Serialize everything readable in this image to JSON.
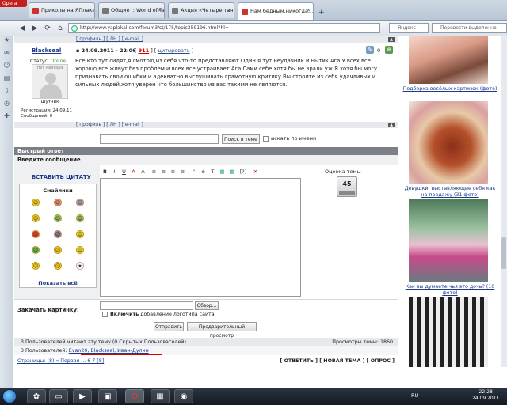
{
  "browser": {
    "menu_label": "Opera",
    "tabs": [
      {
        "title": "Приколы на ЯПлакалъ"
      },
      {
        "title": "Общие :: World of Ta..."
      },
      {
        "title": "Акция «Четыре танки..."
      },
      {
        "title": "Нам бедным,никогда..."
      }
    ],
    "url": "http://www.yaplakal.com/forum3/st/175/topic359196.html?hl=",
    "search_engine": "Яндекс",
    "translate_placeholder": "Перевести выделенно"
  },
  "post": {
    "top_links": "[ профиль ] [ ЛН ] [ e-mail ]",
    "author": "Blackseal",
    "date": "24.09.2011 - 22:06",
    "reputation": "911",
    "quote_label": "цитировать",
    "status_label": "Статус:",
    "status_value": "Online",
    "avatar_label": "Нет Аватара",
    "rank": "Шутник",
    "reg_label": "Регистрация: 24.09.11",
    "posts_label": "Сообщений: 0",
    "comment_count": "0",
    "text": "Все кто тут сидят,я смотрю,из себя что-то представляют.Один я тут неудачник и нытик.Ага.У всех все хорошо,все живут без проблем и всех все устраивает.Ага.Сами себе хотя бы не врали уж.Я хотя бы могу признавать свои ошибки и адекватно выслушивать грамотную критику.Вы строите из себя удачливых и сильных людей,хотя уверен что большинство из вас такими не являются.",
    "bottom_links": "[ профиль ] [ ЛН ] [ e-mail ]"
  },
  "search": {
    "scope_option": "Поиск в теме »",
    "by_name_label": "искать по имени"
  },
  "reply": {
    "header": "Быстрый ответ",
    "subheader": "Введите сообщение",
    "insert_quote": "ВСТАВИТЬ ЦИТАТУ",
    "smilies_title": "Смайлики",
    "show_all": "Показать всё",
    "rating_label": "Оценка темы",
    "rating_value": "45",
    "upload_label": "Закачать картинку:",
    "browse_label": "Обзор...",
    "logo_label_bold": "Включить",
    "logo_label_rest": "добавление логотипа сайта",
    "submit_label": "Отправить",
    "preview_label": "Предварительный просмотр",
    "toolbar": [
      "B",
      "I",
      "U",
      "A",
      "A",
      "≡",
      "≡",
      "≡",
      "≡",
      "\"",
      "#",
      "T",
      "▦",
      "▦",
      "[?]",
      "✕"
    ]
  },
  "footer": {
    "readers_text": "3 Пользователей читают эту тему (0 Скрытых Пользователей)",
    "views_text": "Просмотры темы: 1860",
    "users_prefix": "3 Пользователей:",
    "users": "Evan20, Blackseal, Иван-Дулин",
    "pages_text": "Страницы: (8) « Первая ... 6 7 [8]",
    "actions_text": "[ ОТВЕТИТЬ ] [ НОВАЯ ТЕМА ] [ ОПРОС ]"
  },
  "sidebar": {
    "items": [
      {
        "caption": "Подборка весёлых картинок (фото)"
      },
      {
        "caption": "Девушки, выставляющие себя как на продажу (31 фото)"
      },
      {
        "caption": "Как вы думаете чья это дочь? (10 фото)"
      }
    ]
  },
  "taskbar": {
    "lang": "RU",
    "time": "22:28",
    "date": "24.09.2011"
  },
  "colors": {
    "accent": "#c41f1f",
    "link": "#1a3a8a",
    "online": "#2a9a2a"
  }
}
